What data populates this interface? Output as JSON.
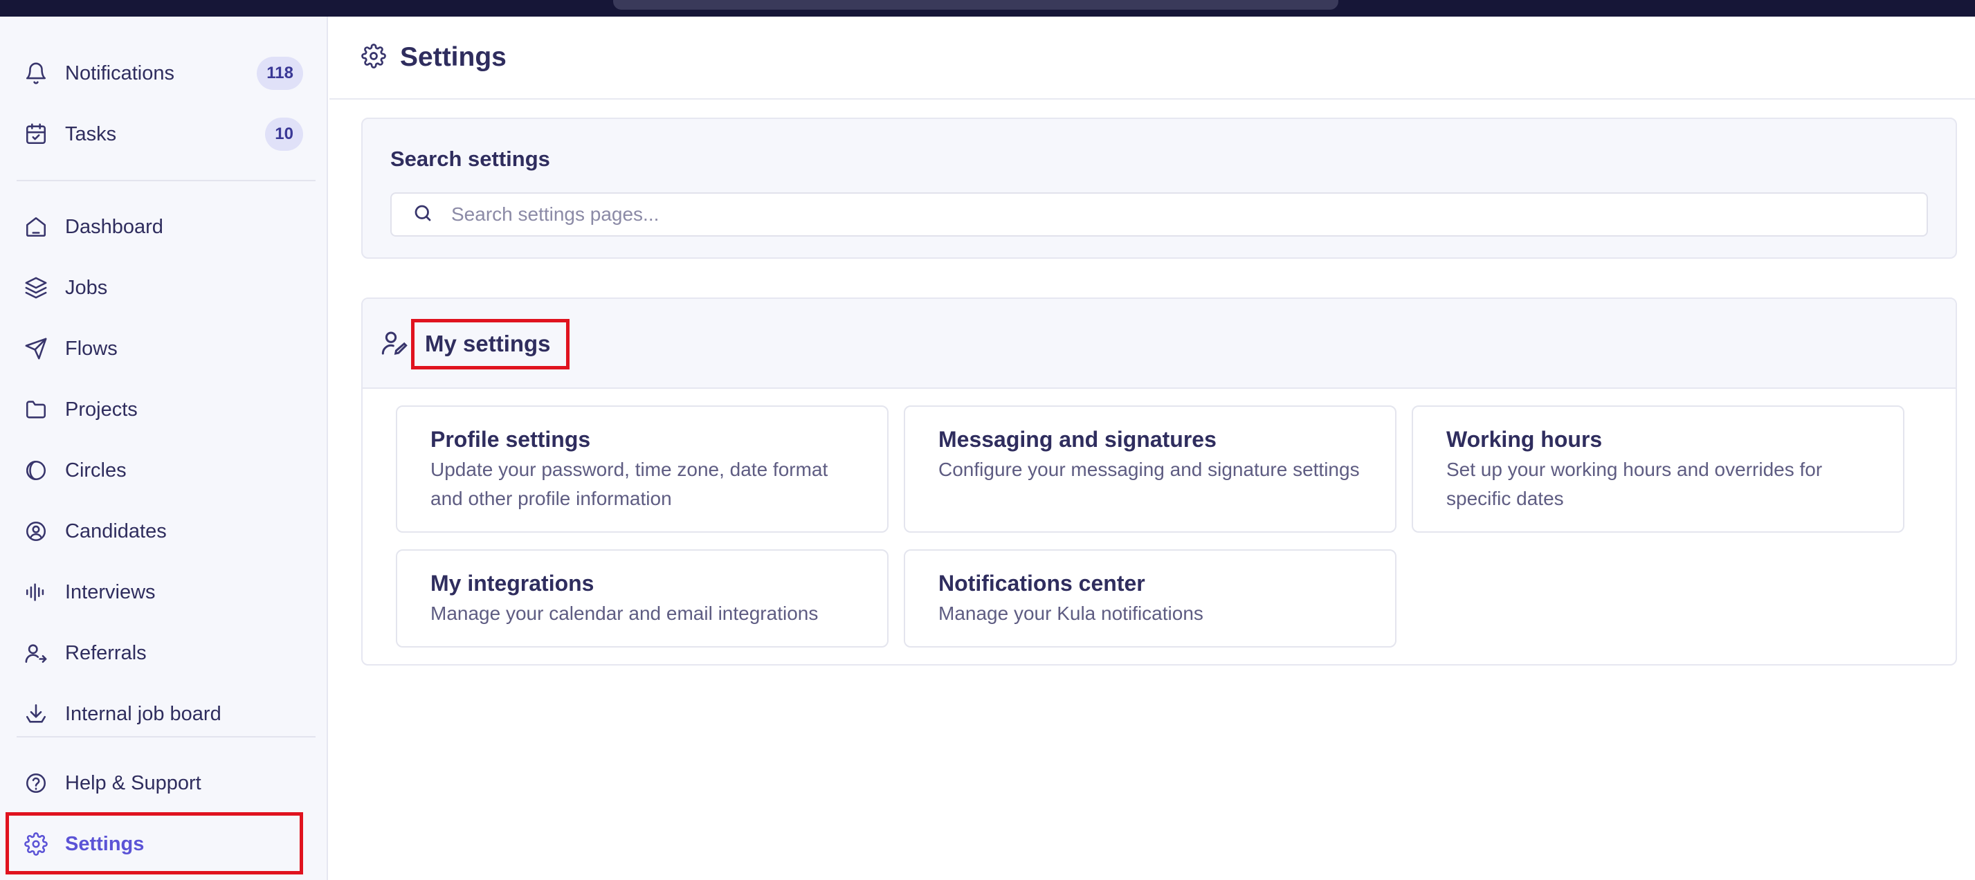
{
  "sidebar": {
    "top_items": [
      {
        "label": "Notifications",
        "badge": "118"
      },
      {
        "label": "Tasks",
        "badge": "10"
      }
    ],
    "nav_items": [
      {
        "label": "Dashboard"
      },
      {
        "label": "Jobs"
      },
      {
        "label": "Flows"
      },
      {
        "label": "Projects"
      },
      {
        "label": "Circles"
      },
      {
        "label": "Candidates"
      },
      {
        "label": "Interviews"
      },
      {
        "label": "Referrals"
      },
      {
        "label": "Internal job board"
      }
    ],
    "bottom_items": [
      {
        "label": "Help & Support"
      },
      {
        "label": "Settings"
      }
    ]
  },
  "header": {
    "title": "Settings"
  },
  "search": {
    "title": "Search settings",
    "placeholder": "Search settings pages..."
  },
  "my_settings": {
    "title": "My settings",
    "cards": [
      {
        "title": "Profile settings",
        "description": "Update your password, time zone, date format and other profile information"
      },
      {
        "title": "Messaging and signatures",
        "description": "Configure your messaging and signature settings"
      },
      {
        "title": "Working hours",
        "description": "Set up your working hours and overrides for specific dates"
      },
      {
        "title": "My integrations",
        "description": "Manage your calendar and email integrations"
      },
      {
        "title": "Notifications center",
        "description": "Manage your Kula notifications"
      }
    ]
  },
  "colors": {
    "accent": "#5b53d6",
    "highlight": "#e0131f",
    "text": "#2f2d5e"
  }
}
